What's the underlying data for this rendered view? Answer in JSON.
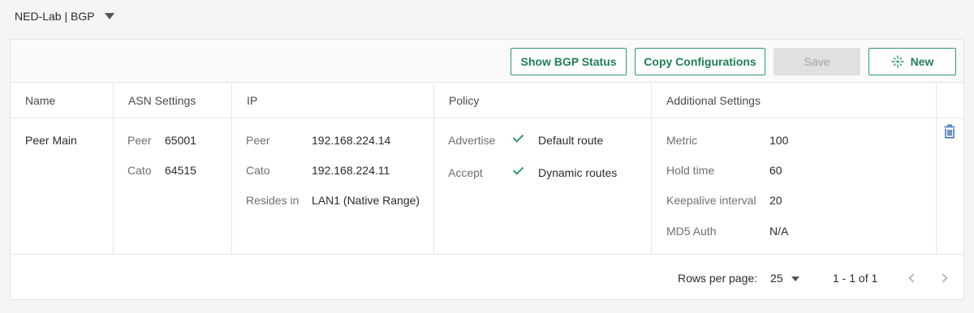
{
  "header": {
    "title": "NED-Lab | BGP"
  },
  "toolbar": {
    "show_bgp_status": "Show BGP Status",
    "copy_configurations": "Copy Configurations",
    "save": "Save",
    "new": "New"
  },
  "table": {
    "columns": [
      "Name",
      "ASN Settings",
      "IP",
      "Policy",
      "Additional Settings"
    ],
    "rows": [
      {
        "name": "Peer Main",
        "asn": {
          "peer_label": "Peer",
          "peer_value": "65001",
          "cato_label": "Cato",
          "cato_value": "64515"
        },
        "ip": {
          "peer_label": "Peer",
          "peer_value": "192.168.224.14",
          "cato_label": "Cato",
          "cato_value": "192.168.224.11",
          "resides_label": "Resides in",
          "resides_value": "LAN1 (Native Range)"
        },
        "policy": {
          "advertise_label": "Advertise",
          "advertise_value": "Default route",
          "accept_label": "Accept",
          "accept_value": "Dynamic routes"
        },
        "additional": {
          "metric_label": "Metric",
          "metric_value": "100",
          "hold_label": "Hold time",
          "hold_value": "60",
          "keepalive_label": "Keepalive interval",
          "keepalive_value": "20",
          "md5_label": "MD5 Auth",
          "md5_value": "N/A"
        }
      }
    ]
  },
  "pagination": {
    "rows_per_page_label": "Rows per page:",
    "rows_per_page_value": "25",
    "range": "1 - 1 of 1"
  },
  "colors": {
    "accent": "#2f9a6a",
    "delete_icon": "#3d6fb0"
  }
}
